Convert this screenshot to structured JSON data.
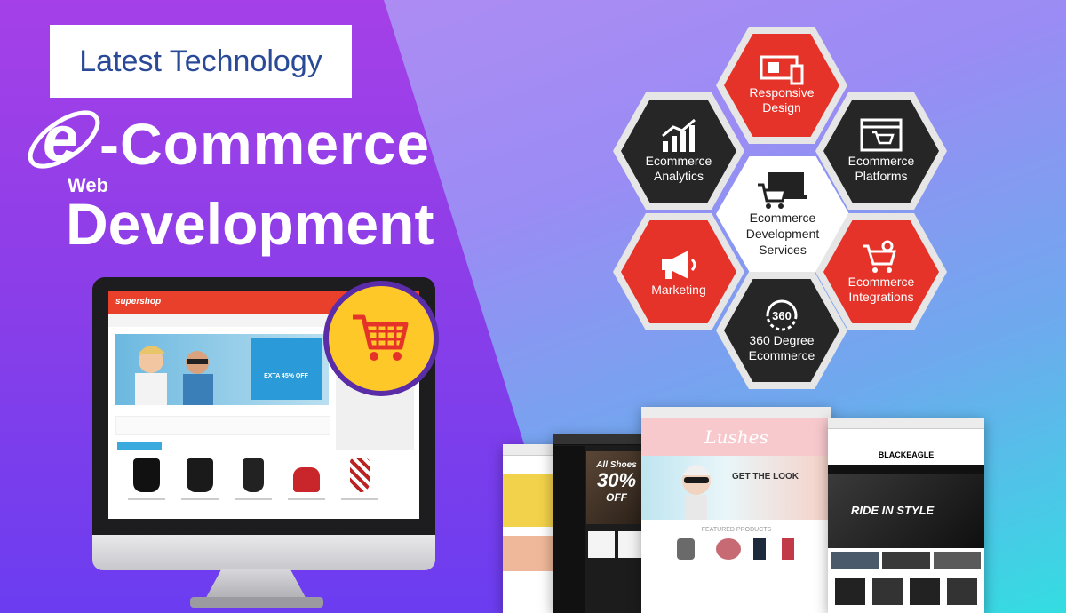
{
  "badge": {
    "text": "Latest Technology"
  },
  "headline": {
    "commerce": "-Commerce",
    "web": "Web",
    "development": "Development"
  },
  "monitor_site": {
    "brand": "supershop",
    "promo": "EXTA 45% OFF"
  },
  "hexagons": {
    "responsive_design": "Responsive Design",
    "ecommerce_analytics": "Ecommerce Analytics",
    "ecommerce_platforms": "Ecommerce Platforms",
    "center": "Ecommerce Development Services",
    "marketing": "Marketing",
    "ecommerce_integrations": "Ecommerce Integrations",
    "degree_360": "360 Degree Ecommerce",
    "degree_360_icon_text": "360"
  },
  "sites": {
    "left_promo_line1": "All Shoes",
    "left_promo_line2": "30%",
    "left_promo_line3": "OFF",
    "middle_brand": "Lushes",
    "middle_tagline": "GET THE LOOK",
    "middle_section": "FEATURED PRODUCTS",
    "right_brand": "BLACKEAGLE",
    "right_hero": "RIDE IN STYLE"
  },
  "colors": {
    "accent_red": "#e53329",
    "hex_dark": "#262626",
    "cart_yellow": "#ffc829",
    "badge_text": "#2a4a98"
  }
}
